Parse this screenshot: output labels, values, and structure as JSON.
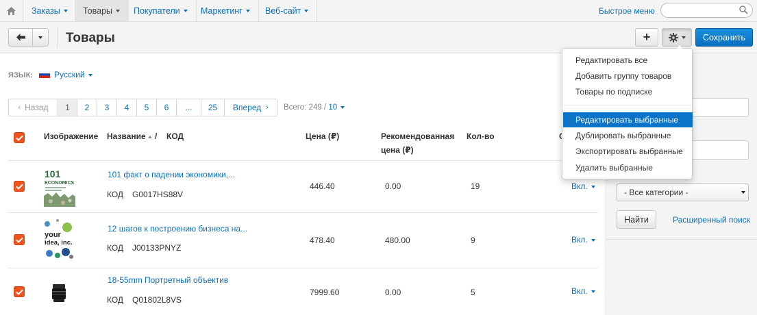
{
  "nav": {
    "items": [
      {
        "label": "Заказы"
      },
      {
        "label": "Товары"
      },
      {
        "label": "Покупатели"
      },
      {
        "label": "Маркетинг"
      },
      {
        "label": "Веб-сайт"
      }
    ],
    "quick_menu": "Быстрое меню",
    "search_placeholder": ""
  },
  "toolbar": {
    "title": "Товары",
    "add_label": "+",
    "save_label": "Сохранить"
  },
  "language": {
    "label": "ЯЗЫК:",
    "value": "Русский"
  },
  "pagination": {
    "prev": "Назад",
    "pages": [
      "1",
      "2",
      "3",
      "4",
      "5",
      "6",
      "...",
      "25"
    ],
    "next": "Вперед",
    "total_label": "Всего: 249 /",
    "per_page": "10"
  },
  "table": {
    "headers": {
      "image": "Изображение",
      "name": "Название",
      "sep": "/",
      "code": "КОД",
      "price": "Цена (₽)",
      "recommended_1": "Рекомендованная",
      "recommended_2": "цена (₽)",
      "qty": "Кол-во",
      "status": "С"
    },
    "code_label": "КОД",
    "rows": [
      {
        "name": "101 факт о падении экономики,...",
        "code": "G0017HS88V",
        "price": "446.40",
        "recommended": "0.00",
        "qty": "19",
        "status": "Вкл."
      },
      {
        "name": "12 шагов к построению бизнеса на...",
        "code": "J00133PNYZ",
        "price": "478.40",
        "recommended": "480.00",
        "qty": "9",
        "status": "Вкл."
      },
      {
        "name": "18-55mm Портретный объектив",
        "code": "Q01802L8VS",
        "price": "7999.60",
        "recommended": "0.00",
        "qty": "5",
        "status": "Вкл."
      }
    ]
  },
  "sidebar": {
    "category_select": "- Все категории -",
    "find_label": "Найти",
    "advanced_search": "Расширенный поиск"
  },
  "dropdown": {
    "items": [
      "Редактировать все",
      "Добавить группу товаров",
      "Товары по подписке",
      "Редактировать выбранные",
      "Дублировать выбранные",
      "Экспортировать выбранные",
      "Удалить выбранные"
    ],
    "highlighted_index": 3
  },
  "thumbnails": {
    "book1_title_1": "101",
    "book1_title_2": "ECONOMICS",
    "book2_title_1": "your",
    "book2_title_2": "idea, inc."
  },
  "colors": {
    "link": "#0b6fb6",
    "primary": "#0b74c8",
    "checkbox": "#f0541e"
  }
}
